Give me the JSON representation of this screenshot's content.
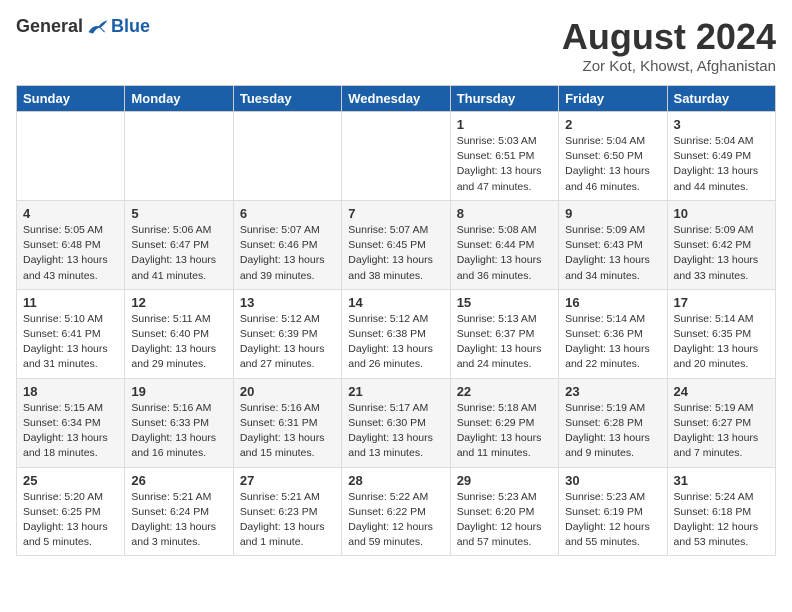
{
  "logo": {
    "general": "General",
    "blue": "Blue"
  },
  "title": {
    "month_year": "August 2024",
    "location": "Zor Kot, Khowst, Afghanistan"
  },
  "header": {
    "days": [
      "Sunday",
      "Monday",
      "Tuesday",
      "Wednesday",
      "Thursday",
      "Friday",
      "Saturday"
    ]
  },
  "weeks": [
    {
      "cells": [
        {
          "day": "",
          "info": ""
        },
        {
          "day": "",
          "info": ""
        },
        {
          "day": "",
          "info": ""
        },
        {
          "day": "",
          "info": ""
        },
        {
          "day": "1",
          "info": "Sunrise: 5:03 AM\nSunset: 6:51 PM\nDaylight: 13 hours\nand 47 minutes."
        },
        {
          "day": "2",
          "info": "Sunrise: 5:04 AM\nSunset: 6:50 PM\nDaylight: 13 hours\nand 46 minutes."
        },
        {
          "day": "3",
          "info": "Sunrise: 5:04 AM\nSunset: 6:49 PM\nDaylight: 13 hours\nand 44 minutes."
        }
      ]
    },
    {
      "cells": [
        {
          "day": "4",
          "info": "Sunrise: 5:05 AM\nSunset: 6:48 PM\nDaylight: 13 hours\nand 43 minutes."
        },
        {
          "day": "5",
          "info": "Sunrise: 5:06 AM\nSunset: 6:47 PM\nDaylight: 13 hours\nand 41 minutes."
        },
        {
          "day": "6",
          "info": "Sunrise: 5:07 AM\nSunset: 6:46 PM\nDaylight: 13 hours\nand 39 minutes."
        },
        {
          "day": "7",
          "info": "Sunrise: 5:07 AM\nSunset: 6:45 PM\nDaylight: 13 hours\nand 38 minutes."
        },
        {
          "day": "8",
          "info": "Sunrise: 5:08 AM\nSunset: 6:44 PM\nDaylight: 13 hours\nand 36 minutes."
        },
        {
          "day": "9",
          "info": "Sunrise: 5:09 AM\nSunset: 6:43 PM\nDaylight: 13 hours\nand 34 minutes."
        },
        {
          "day": "10",
          "info": "Sunrise: 5:09 AM\nSunset: 6:42 PM\nDaylight: 13 hours\nand 33 minutes."
        }
      ]
    },
    {
      "cells": [
        {
          "day": "11",
          "info": "Sunrise: 5:10 AM\nSunset: 6:41 PM\nDaylight: 13 hours\nand 31 minutes."
        },
        {
          "day": "12",
          "info": "Sunrise: 5:11 AM\nSunset: 6:40 PM\nDaylight: 13 hours\nand 29 minutes."
        },
        {
          "day": "13",
          "info": "Sunrise: 5:12 AM\nSunset: 6:39 PM\nDaylight: 13 hours\nand 27 minutes."
        },
        {
          "day": "14",
          "info": "Sunrise: 5:12 AM\nSunset: 6:38 PM\nDaylight: 13 hours\nand 26 minutes."
        },
        {
          "day": "15",
          "info": "Sunrise: 5:13 AM\nSunset: 6:37 PM\nDaylight: 13 hours\nand 24 minutes."
        },
        {
          "day": "16",
          "info": "Sunrise: 5:14 AM\nSunset: 6:36 PM\nDaylight: 13 hours\nand 22 minutes."
        },
        {
          "day": "17",
          "info": "Sunrise: 5:14 AM\nSunset: 6:35 PM\nDaylight: 13 hours\nand 20 minutes."
        }
      ]
    },
    {
      "cells": [
        {
          "day": "18",
          "info": "Sunrise: 5:15 AM\nSunset: 6:34 PM\nDaylight: 13 hours\nand 18 minutes."
        },
        {
          "day": "19",
          "info": "Sunrise: 5:16 AM\nSunset: 6:33 PM\nDaylight: 13 hours\nand 16 minutes."
        },
        {
          "day": "20",
          "info": "Sunrise: 5:16 AM\nSunset: 6:31 PM\nDaylight: 13 hours\nand 15 minutes."
        },
        {
          "day": "21",
          "info": "Sunrise: 5:17 AM\nSunset: 6:30 PM\nDaylight: 13 hours\nand 13 minutes."
        },
        {
          "day": "22",
          "info": "Sunrise: 5:18 AM\nSunset: 6:29 PM\nDaylight: 13 hours\nand 11 minutes."
        },
        {
          "day": "23",
          "info": "Sunrise: 5:19 AM\nSunset: 6:28 PM\nDaylight: 13 hours\nand 9 minutes."
        },
        {
          "day": "24",
          "info": "Sunrise: 5:19 AM\nSunset: 6:27 PM\nDaylight: 13 hours\nand 7 minutes."
        }
      ]
    },
    {
      "cells": [
        {
          "day": "25",
          "info": "Sunrise: 5:20 AM\nSunset: 6:25 PM\nDaylight: 13 hours\nand 5 minutes."
        },
        {
          "day": "26",
          "info": "Sunrise: 5:21 AM\nSunset: 6:24 PM\nDaylight: 13 hours\nand 3 minutes."
        },
        {
          "day": "27",
          "info": "Sunrise: 5:21 AM\nSunset: 6:23 PM\nDaylight: 13 hours\nand 1 minute."
        },
        {
          "day": "28",
          "info": "Sunrise: 5:22 AM\nSunset: 6:22 PM\nDaylight: 12 hours\nand 59 minutes."
        },
        {
          "day": "29",
          "info": "Sunrise: 5:23 AM\nSunset: 6:20 PM\nDaylight: 12 hours\nand 57 minutes."
        },
        {
          "day": "30",
          "info": "Sunrise: 5:23 AM\nSunset: 6:19 PM\nDaylight: 12 hours\nand 55 minutes."
        },
        {
          "day": "31",
          "info": "Sunrise: 5:24 AM\nSunset: 6:18 PM\nDaylight: 12 hours\nand 53 minutes."
        }
      ]
    }
  ]
}
